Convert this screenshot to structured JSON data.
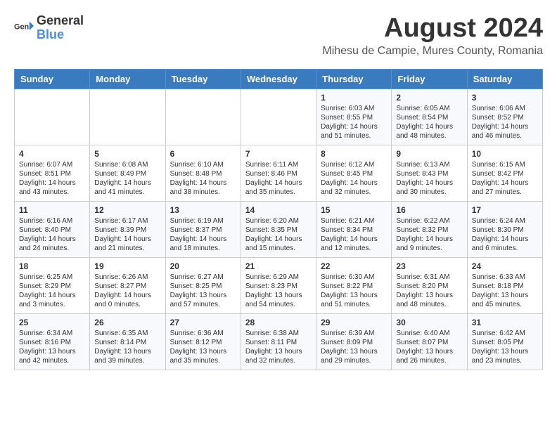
{
  "header": {
    "logo_general": "General",
    "logo_blue": "Blue",
    "month_year": "August 2024",
    "location": "Mihesu de Campie, Mures County, Romania"
  },
  "weekdays": [
    "Sunday",
    "Monday",
    "Tuesday",
    "Wednesday",
    "Thursday",
    "Friday",
    "Saturday"
  ],
  "weeks": [
    [
      {
        "day": "",
        "info": ""
      },
      {
        "day": "",
        "info": ""
      },
      {
        "day": "",
        "info": ""
      },
      {
        "day": "",
        "info": ""
      },
      {
        "day": "1",
        "info": "Sunrise: 6:03 AM\nSunset: 8:55 PM\nDaylight: 14 hours and 51 minutes."
      },
      {
        "day": "2",
        "info": "Sunrise: 6:05 AM\nSunset: 8:54 PM\nDaylight: 14 hours and 48 minutes."
      },
      {
        "day": "3",
        "info": "Sunrise: 6:06 AM\nSunset: 8:52 PM\nDaylight: 14 hours and 46 minutes."
      }
    ],
    [
      {
        "day": "4",
        "info": "Sunrise: 6:07 AM\nSunset: 8:51 PM\nDaylight: 14 hours and 43 minutes."
      },
      {
        "day": "5",
        "info": "Sunrise: 6:08 AM\nSunset: 8:49 PM\nDaylight: 14 hours and 41 minutes."
      },
      {
        "day": "6",
        "info": "Sunrise: 6:10 AM\nSunset: 8:48 PM\nDaylight: 14 hours and 38 minutes."
      },
      {
        "day": "7",
        "info": "Sunrise: 6:11 AM\nSunset: 8:46 PM\nDaylight: 14 hours and 35 minutes."
      },
      {
        "day": "8",
        "info": "Sunrise: 6:12 AM\nSunset: 8:45 PM\nDaylight: 14 hours and 32 minutes."
      },
      {
        "day": "9",
        "info": "Sunrise: 6:13 AM\nSunset: 8:43 PM\nDaylight: 14 hours and 30 minutes."
      },
      {
        "day": "10",
        "info": "Sunrise: 6:15 AM\nSunset: 8:42 PM\nDaylight: 14 hours and 27 minutes."
      }
    ],
    [
      {
        "day": "11",
        "info": "Sunrise: 6:16 AM\nSunset: 8:40 PM\nDaylight: 14 hours and 24 minutes."
      },
      {
        "day": "12",
        "info": "Sunrise: 6:17 AM\nSunset: 8:39 PM\nDaylight: 14 hours and 21 minutes."
      },
      {
        "day": "13",
        "info": "Sunrise: 6:19 AM\nSunset: 8:37 PM\nDaylight: 14 hours and 18 minutes."
      },
      {
        "day": "14",
        "info": "Sunrise: 6:20 AM\nSunset: 8:35 PM\nDaylight: 14 hours and 15 minutes."
      },
      {
        "day": "15",
        "info": "Sunrise: 6:21 AM\nSunset: 8:34 PM\nDaylight: 14 hours and 12 minutes."
      },
      {
        "day": "16",
        "info": "Sunrise: 6:22 AM\nSunset: 8:32 PM\nDaylight: 14 hours and 9 minutes."
      },
      {
        "day": "17",
        "info": "Sunrise: 6:24 AM\nSunset: 8:30 PM\nDaylight: 14 hours and 6 minutes."
      }
    ],
    [
      {
        "day": "18",
        "info": "Sunrise: 6:25 AM\nSunset: 8:29 PM\nDaylight: 14 hours and 3 minutes."
      },
      {
        "day": "19",
        "info": "Sunrise: 6:26 AM\nSunset: 8:27 PM\nDaylight: 14 hours and 0 minutes."
      },
      {
        "day": "20",
        "info": "Sunrise: 6:27 AM\nSunset: 8:25 PM\nDaylight: 13 hours and 57 minutes."
      },
      {
        "day": "21",
        "info": "Sunrise: 6:29 AM\nSunset: 8:23 PM\nDaylight: 13 hours and 54 minutes."
      },
      {
        "day": "22",
        "info": "Sunrise: 6:30 AM\nSunset: 8:22 PM\nDaylight: 13 hours and 51 minutes."
      },
      {
        "day": "23",
        "info": "Sunrise: 6:31 AM\nSunset: 8:20 PM\nDaylight: 13 hours and 48 minutes."
      },
      {
        "day": "24",
        "info": "Sunrise: 6:33 AM\nSunset: 8:18 PM\nDaylight: 13 hours and 45 minutes."
      }
    ],
    [
      {
        "day": "25",
        "info": "Sunrise: 6:34 AM\nSunset: 8:16 PM\nDaylight: 13 hours and 42 minutes."
      },
      {
        "day": "26",
        "info": "Sunrise: 6:35 AM\nSunset: 8:14 PM\nDaylight: 13 hours and 39 minutes."
      },
      {
        "day": "27",
        "info": "Sunrise: 6:36 AM\nSunset: 8:12 PM\nDaylight: 13 hours and 35 minutes."
      },
      {
        "day": "28",
        "info": "Sunrise: 6:38 AM\nSunset: 8:11 PM\nDaylight: 13 hours and 32 minutes."
      },
      {
        "day": "29",
        "info": "Sunrise: 6:39 AM\nSunset: 8:09 PM\nDaylight: 13 hours and 29 minutes."
      },
      {
        "day": "30",
        "info": "Sunrise: 6:40 AM\nSunset: 8:07 PM\nDaylight: 13 hours and 26 minutes."
      },
      {
        "day": "31",
        "info": "Sunrise: 6:42 AM\nSunset: 8:05 PM\nDaylight: 13 hours and 23 minutes."
      }
    ]
  ]
}
